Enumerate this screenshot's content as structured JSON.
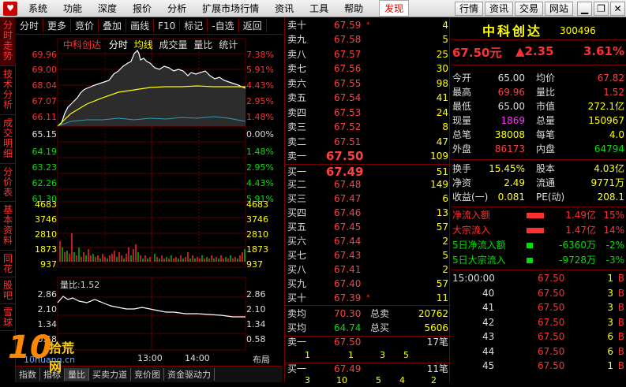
{
  "menu": {
    "items": [
      "系统",
      "功能",
      "深度",
      "报价",
      "分析",
      "扩展市场行情",
      "资讯",
      "工具",
      "帮助"
    ],
    "discover": "发现",
    "logo_glyph": "♥"
  },
  "right_tabs": [
    "行情",
    "资讯",
    "交易",
    "网站"
  ],
  "window_controls": {
    "min": "▁",
    "max": "❐",
    "close": "✕"
  },
  "sidebar": [
    "分时走势",
    "技术分析",
    "成交明细",
    "分价表",
    "基本资料",
    "同花",
    "股吧",
    "雪球"
  ],
  "chart_toolbar": [
    "分时",
    "更多",
    "竞价",
    "叠加",
    "画线",
    "F10",
    "标记",
    "-自选",
    "返回"
  ],
  "chart": {
    "title": "中科创达",
    "legend": [
      "分时",
      "均线",
      "成交量",
      "量比",
      "统计"
    ],
    "price_labels": [
      "69.96",
      "69.00",
      "68.04",
      "67.07",
      "66.11",
      "65.15",
      "64.19",
      "63.23",
      "62.26",
      "61.30"
    ],
    "pct_labels": [
      "7.38%",
      "5.91%",
      "4.43%",
      "2.95%",
      "1.48%",
      "0.00%",
      "1.48%",
      "2.95%",
      "4.43%",
      "5.91%"
    ],
    "vol_labels": [
      "4683",
      "3746",
      "2810",
      "1873",
      "937"
    ],
    "ratio_title": "量比:1.52",
    "ratio_labels": [
      "2.86",
      "2.10",
      "1.34",
      "0.58"
    ],
    "time_labels": [
      "13:00",
      "14:00"
    ],
    "layout_label": "布局"
  },
  "bottom_tabs": [
    "指数",
    "指标",
    "量比",
    "买卖力道",
    "竞价图",
    "资金驱动力"
  ],
  "orderbook": {
    "sells": [
      {
        "label": "卖十",
        "price": "67.59",
        "vol": "4"
      },
      {
        "label": "卖九",
        "price": "67.58",
        "vol": "5"
      },
      {
        "label": "卖八",
        "price": "67.57",
        "vol": "25"
      },
      {
        "label": "卖七",
        "price": "67.56",
        "vol": "30"
      },
      {
        "label": "卖六",
        "price": "67.55",
        "vol": "98"
      },
      {
        "label": "卖五",
        "price": "67.54",
        "vol": "41"
      },
      {
        "label": "卖四",
        "price": "67.53",
        "vol": "24"
      },
      {
        "label": "卖三",
        "price": "67.52",
        "vol": "8"
      },
      {
        "label": "卖二",
        "price": "67.51",
        "vol": "47"
      },
      {
        "label": "卖一",
        "price": "67.50",
        "vol": "109"
      }
    ],
    "buys": [
      {
        "label": "买一",
        "price": "67.49",
        "vol": "51"
      },
      {
        "label": "买二",
        "price": "67.48",
        "vol": "149"
      },
      {
        "label": "买三",
        "price": "67.47",
        "vol": "6"
      },
      {
        "label": "买四",
        "price": "67.46",
        "vol": "13"
      },
      {
        "label": "买五",
        "price": "67.45",
        "vol": "57"
      },
      {
        "label": "买六",
        "price": "67.44",
        "vol": "2"
      },
      {
        "label": "买七",
        "price": "67.43",
        "vol": "5"
      },
      {
        "label": "买八",
        "price": "67.41",
        "vol": "2"
      },
      {
        "label": "买九",
        "price": "67.40",
        "vol": "57"
      },
      {
        "label": "买十",
        "price": "67.39",
        "vol": "11"
      }
    ],
    "avg_sell": {
      "label": "卖均",
      "price": "70.30",
      "tot_label": "总卖",
      "tot": "20762"
    },
    "avg_buy": {
      "label": "买均",
      "price": "64.74",
      "tot_label": "总买",
      "tot": "5606"
    },
    "sell1_detail": {
      "label": "卖一",
      "price": "67.50",
      "count": "17笔",
      "nums": [
        "1",
        "1",
        "3",
        "5"
      ]
    },
    "buy1_detail": {
      "label": "买一",
      "price": "67.49",
      "count": "11笔",
      "nums": [
        "3",
        "10",
        "5",
        "4",
        "2"
      ]
    }
  },
  "quote": {
    "name": "中科创达",
    "code": "300496",
    "price": "67.50元",
    "change": "▲2.35",
    "pct": "3.61%",
    "rows": [
      [
        "今开",
        "65.00",
        "均价",
        "67.82"
      ],
      [
        "最高",
        "69.96",
        "量比",
        "1.52"
      ],
      [
        "最低",
        "65.00",
        "市值",
        "272.1亿"
      ],
      [
        "现量",
        "1869",
        "总量",
        "150967"
      ],
      [
        "总笔",
        "38008",
        "每笔",
        "4.0"
      ],
      [
        "外盘",
        "86173",
        "内盘",
        "64794"
      ],
      [
        "换手",
        "15.45%",
        "股本",
        "4.03亿"
      ],
      [
        "净资",
        "2.49",
        "流通",
        "9771万"
      ],
      [
        "收益(一)",
        "0.081",
        "PE(动)",
        "208.1"
      ]
    ],
    "flows": [
      {
        "label": "净流入额",
        "val": "1.49亿",
        "pct": "15%"
      },
      {
        "label": "大宗流入",
        "val": "1.47亿",
        "pct": "14%"
      },
      {
        "label": "5日净流入额",
        "val": "-6360万",
        "pct": "-2%"
      },
      {
        "label": "5日大宗流入",
        "val": "-9728万",
        "pct": "-3%"
      }
    ],
    "ticks": [
      {
        "time": "15:00:00",
        "price": "67.50",
        "vol": "1",
        "side": "B"
      },
      {
        "time": "40",
        "price": "67.50",
        "vol": "3",
        "side": "B"
      },
      {
        "time": "41",
        "price": "67.50",
        "vol": "3",
        "side": "B"
      },
      {
        "time": "42",
        "price": "67.50",
        "vol": "3",
        "side": "B"
      },
      {
        "time": "43",
        "price": "67.50",
        "vol": "6",
        "side": "B"
      },
      {
        "time": "44",
        "price": "67.50",
        "vol": "6",
        "side": "B"
      },
      {
        "time": "45",
        "price": "67.50",
        "vol": "1",
        "side": "B"
      }
    ]
  },
  "watermark": {
    "num": "10",
    "cn": "拾荒网",
    "url": "10huang.cn"
  }
}
